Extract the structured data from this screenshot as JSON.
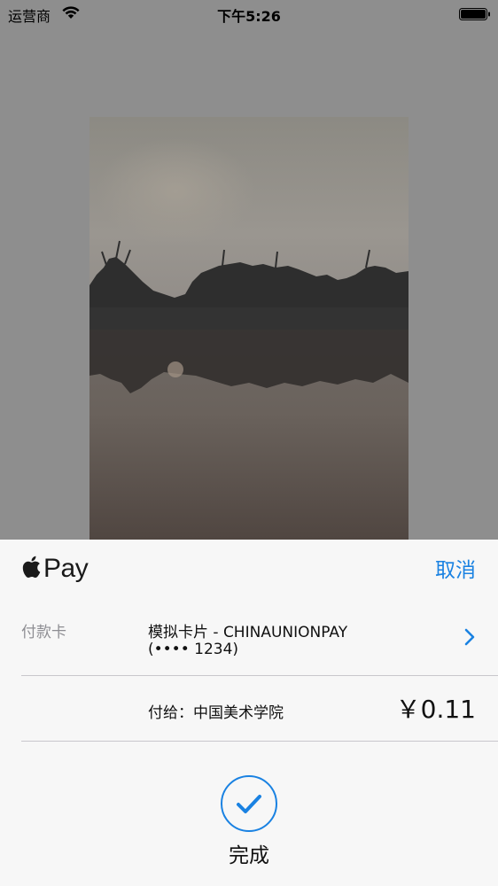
{
  "status_bar": {
    "carrier": "运营商",
    "time": "下午5:26"
  },
  "sheet": {
    "apple_pay_label": "Pay",
    "cancel_label": "取消",
    "card_label": "付款卡",
    "card_name": "模拟卡片 - CHINAUNIONPAY",
    "card_number": "(•••• 1234)",
    "payee": "付给：中国美术学院",
    "amount": "￥0.11",
    "done_label": "完成"
  },
  "colors": {
    "accent": "#1a82e2",
    "overlay": "#8e8e8e",
    "sheet_background": "#f7f7f7"
  },
  "icons": [
    "wifi-icon",
    "battery-icon",
    "apple-logo-icon",
    "chevron-right-icon",
    "checkmark-icon"
  ]
}
